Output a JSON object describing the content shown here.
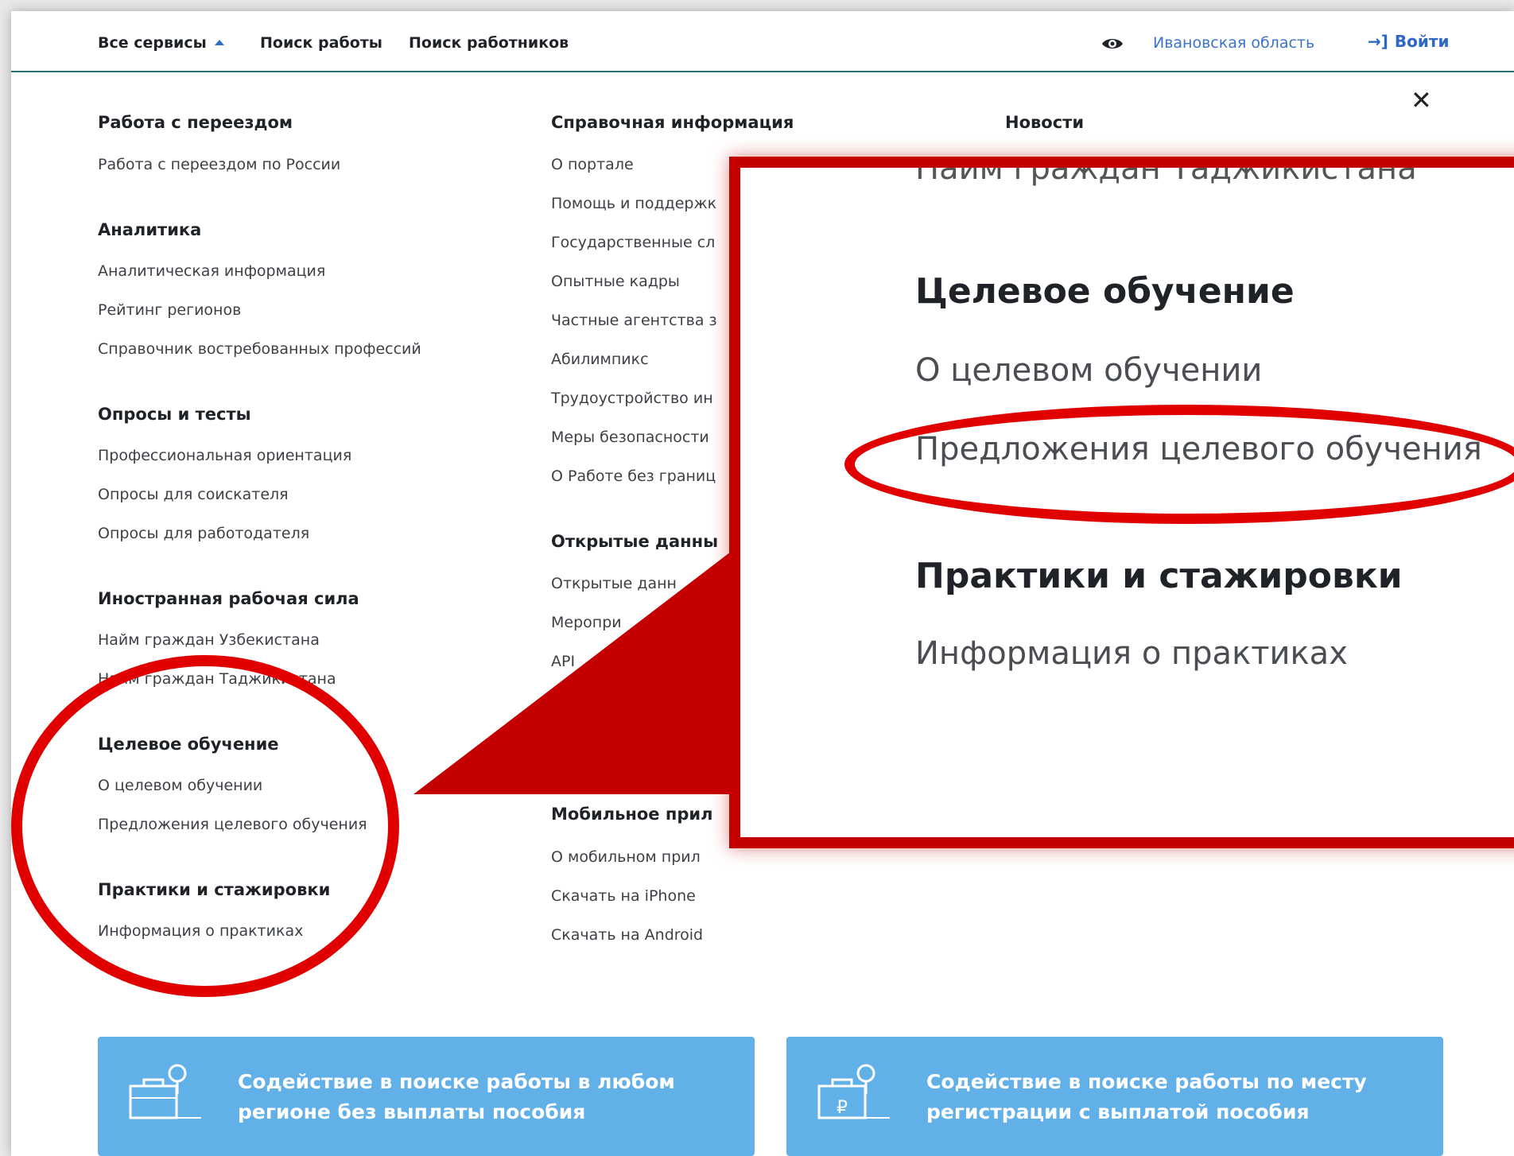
{
  "header": {
    "all_services": "Все сервисы",
    "job_search": "Поиск работы",
    "worker_search": "Поиск работников",
    "region": "Ивановская область",
    "login": "Войти"
  },
  "menu": {
    "col1": {
      "relocation": {
        "title": "Работа с переездом",
        "links": [
          "Работа с переездом по России"
        ]
      },
      "analytics": {
        "title": "Аналитика",
        "links": [
          "Аналитическая информация",
          "Рейтинг регионов",
          "Справочник востребованных профессий"
        ]
      },
      "surveys": {
        "title": "Опросы и тесты",
        "links": [
          "Профессиональная ориентация",
          "Опросы для соискателя",
          "Опросы для работодателя"
        ]
      },
      "foreign": {
        "title": "Иностранная рабочая сила",
        "links": [
          "Найм граждан Узбекистана",
          "Найм граждан Таджикистана"
        ]
      },
      "targeted": {
        "title": "Целевое обучение",
        "links": [
          "О целевом обучении",
          "Предложения целевого обучения"
        ]
      },
      "practice": {
        "title": "Практики и стажировки",
        "links": [
          "Информация о практиках"
        ]
      }
    },
    "col2": {
      "reference": {
        "title": "Справочная информация",
        "links": [
          "О портале",
          "Помощь и поддержк",
          "Государственные сл",
          "Опытные кадры",
          "Частные агентства з",
          "Абилимпикс",
          "Трудоустройство ин",
          "Меры безопасности",
          "О Работе без границ"
        ]
      },
      "opendata": {
        "title": "Открытые данны",
        "links": [
          "Открытые данн",
          "Меропри",
          "API"
        ]
      },
      "mobile": {
        "title": "Мобильное прил",
        "links": [
          "О мобильном прил",
          "Скачать на iPhone",
          "Скачать на Android"
        ]
      }
    },
    "col3": {
      "news": {
        "title": "Новости"
      }
    }
  },
  "zoom": {
    "cut_text": "Найм граждан Таджикистана",
    "targeted_title": "Целевое обучение",
    "targeted_link1": "О целевом обучении",
    "targeted_link2": "Предложения целевого обучения",
    "practice_title": "Практики и стажировки",
    "practice_link": "Информация о практиках"
  },
  "cards": [
    {
      "text": "Содействие в поиске работы в любом регионе без выплаты пособия",
      "icon": "briefcase-search-icon"
    },
    {
      "text": "Содействие в поиске работы по месту регистрации с выплатой пособия",
      "icon": "briefcase-ruble-search-icon"
    }
  ],
  "colors": {
    "accent_blue": "#2f68c3",
    "highlight_red": "#e00000",
    "card_blue": "#62b0e8"
  }
}
